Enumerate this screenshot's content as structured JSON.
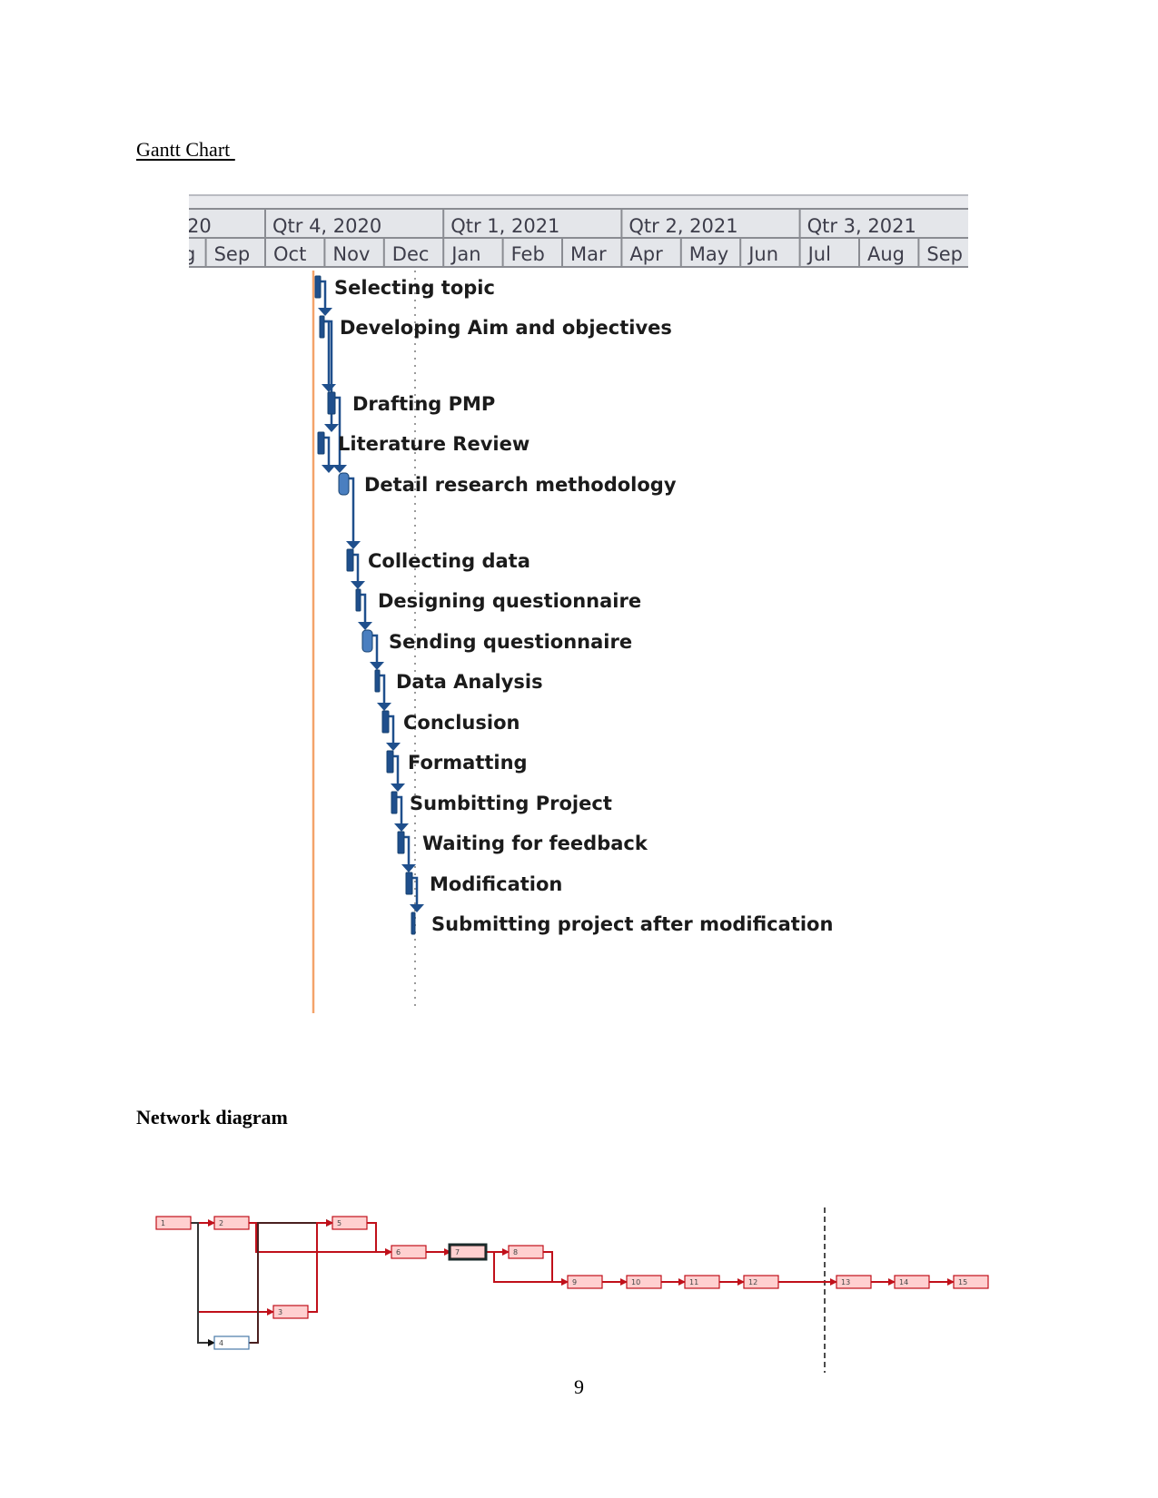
{
  "document": {
    "gantt_heading": "Gantt Chart ",
    "network_heading": "Network diagram",
    "page_number": "9"
  },
  "chart_data": [
    {
      "type": "gantt",
      "title": "Gantt Chart",
      "timescale": {
        "quarters": [
          "20",
          "Qtr 4, 2020",
          "Qtr 1, 2021",
          "Qtr 2, 2021",
          "Qtr 3, 2021"
        ],
        "months": [
          "g",
          "Sep",
          "Oct",
          "Nov",
          "Dec",
          "Jan",
          "Feb",
          "Mar",
          "Apr",
          "May",
          "Jun",
          "Jul",
          "Aug",
          "Sep"
        ]
      },
      "markers": [
        {
          "name": "project-start-line",
          "position_month": "early Oct 2020",
          "color": "#f4a36a"
        },
        {
          "name": "status-date-line",
          "position_month": "mid Dec 2020",
          "style": "dotted",
          "color": "#9a9a9a"
        }
      ],
      "tasks": [
        {
          "id": 1,
          "name": "Selecting topic",
          "start_month_offset": 0.05,
          "duration_months": 0.1,
          "predecessors": []
        },
        {
          "id": 2,
          "name": "Developing Aim and objectives",
          "start_month_offset": 0.2,
          "duration_months": 0.08,
          "predecessors": [
            1
          ]
        },
        {
          "id": 3,
          "name": "Drafting PMP",
          "start_month_offset": 0.28,
          "duration_months": 0.12,
          "predecessors": [
            2
          ]
        },
        {
          "id": 4,
          "name": "Literature Review",
          "start_month_offset": 0.1,
          "duration_months": 0.1,
          "predecessors": [
            2
          ]
        },
        {
          "id": 5,
          "name": "Detail research methodology",
          "start_month_offset": 0.45,
          "duration_months": 0.18,
          "predecessors": [
            3,
            4
          ]
        },
        {
          "id": 6,
          "name": "Collecting data",
          "start_month_offset": 0.6,
          "duration_months": 0.1,
          "predecessors": [
            5
          ]
        },
        {
          "id": 7,
          "name": "Designing questionnaire",
          "start_month_offset": 0.78,
          "duration_months": 0.08,
          "predecessors": [
            6
          ]
        },
        {
          "id": 8,
          "name": "Sending questionnaire",
          "start_month_offset": 0.88,
          "duration_months": 0.2,
          "predecessors": [
            7
          ]
        },
        {
          "id": 9,
          "name": "Data Analysis",
          "start_month_offset": 1.03,
          "duration_months": 0.08,
          "predecessors": [
            8
          ]
        },
        {
          "id": 10,
          "name": "Conclusion",
          "start_month_offset": 1.15,
          "duration_months": 0.12,
          "predecessors": [
            9
          ]
        },
        {
          "id": 11,
          "name": "Formatting",
          "start_month_offset": 1.22,
          "duration_months": 0.12,
          "predecessors": [
            10
          ]
        },
        {
          "id": 12,
          "name": "Sumbitting Project",
          "start_month_offset": 1.28,
          "duration_months": 0.1,
          "predecessors": [
            11
          ]
        },
        {
          "id": 13,
          "name": "Waiting for feedback",
          "start_month_offset": 1.42,
          "duration_months": 0.1,
          "predecessors": [
            12
          ]
        },
        {
          "id": 14,
          "name": "Modification",
          "start_month_offset": 1.55,
          "duration_months": 0.1,
          "predecessors": [
            13
          ]
        },
        {
          "id": 15,
          "name": "Submitting project after modification",
          "start_month_offset": 1.6,
          "duration_months": 0.06,
          "predecessors": [
            14
          ]
        }
      ]
    },
    {
      "type": "network",
      "title": "Network diagram",
      "nodes": [
        {
          "id": "1",
          "critical": true
        },
        {
          "id": "2",
          "critical": true
        },
        {
          "id": "3",
          "critical": true
        },
        {
          "id": "4",
          "critical": false
        },
        {
          "id": "5",
          "critical": true
        },
        {
          "id": "6",
          "critical": true
        },
        {
          "id": "7",
          "critical": true,
          "selected": true
        },
        {
          "id": "8",
          "critical": true
        },
        {
          "id": "9",
          "critical": true
        },
        {
          "id": "10",
          "critical": true
        },
        {
          "id": "11",
          "critical": true
        },
        {
          "id": "12",
          "critical": true
        },
        {
          "id": "13",
          "critical": true
        },
        {
          "id": "14",
          "critical": true
        },
        {
          "id": "15",
          "critical": true
        }
      ],
      "edges": [
        [
          "1",
          "2"
        ],
        [
          "1",
          "3"
        ],
        [
          "1",
          "4"
        ],
        [
          "2",
          "5"
        ],
        [
          "2",
          "6"
        ],
        [
          "4",
          "5"
        ],
        [
          "3",
          "5"
        ],
        [
          "5",
          "6"
        ],
        [
          "6",
          "7"
        ],
        [
          "7",
          "8"
        ],
        [
          "7",
          "9"
        ],
        [
          "8",
          "9"
        ],
        [
          "9",
          "10"
        ],
        [
          "10",
          "11"
        ],
        [
          "11",
          "12"
        ],
        [
          "12",
          "13"
        ],
        [
          "13",
          "14"
        ],
        [
          "14",
          "15"
        ]
      ],
      "colors": {
        "critical_fill": "#ffd0d0",
        "critical_stroke": "#c0101a",
        "noncritical_fill": "#ffffff",
        "noncritical_stroke": "#4a7aa8",
        "link_critical": "#c0101a",
        "link_normal": "#1a1a1a"
      }
    }
  ]
}
